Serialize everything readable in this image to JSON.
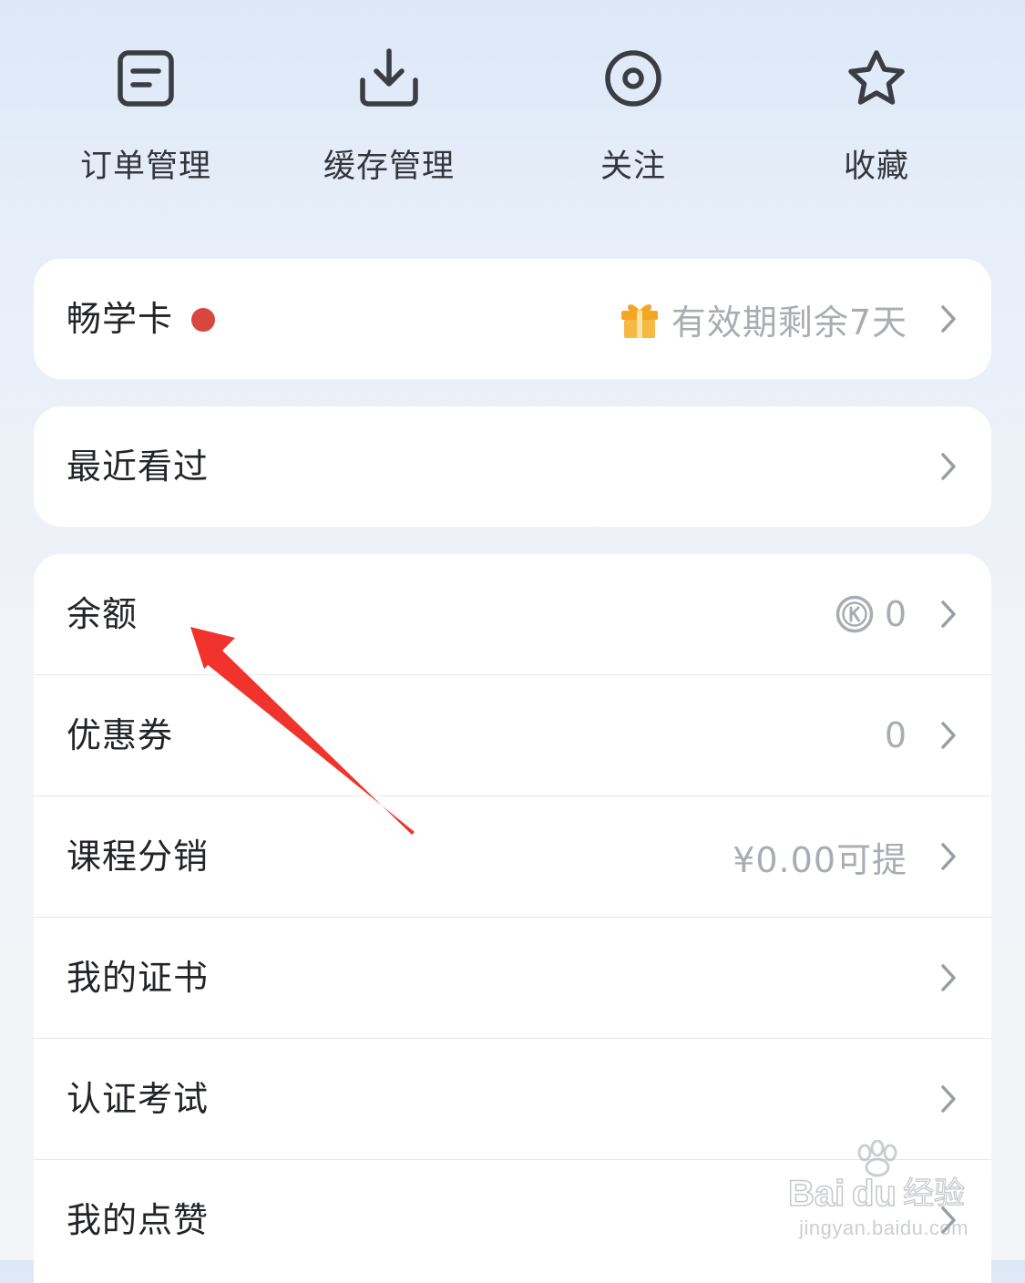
{
  "quick_actions": [
    {
      "label": "订单管理",
      "icon": "order-list-icon"
    },
    {
      "label": "缓存管理",
      "icon": "download-icon"
    },
    {
      "label": "关注",
      "icon": "follow-eye-icon"
    },
    {
      "label": "收藏",
      "icon": "star-icon"
    }
  ],
  "membership": {
    "label": "畅学卡",
    "status": "有效期剩余7天",
    "gift_icon": "gift-icon",
    "dot_color": "#d9453f"
  },
  "recent": {
    "label": "最近看过"
  },
  "account_items": [
    {
      "label": "余额",
      "value": "0",
      "icon": "coin-icon"
    },
    {
      "label": "优惠券",
      "value": "0"
    },
    {
      "label": "课程分销",
      "value": "¥0.00可提"
    },
    {
      "label": "我的证书",
      "value": ""
    },
    {
      "label": "认证考试",
      "value": ""
    },
    {
      "label": "我的点赞",
      "value": ""
    }
  ],
  "colors": {
    "accent_red": "#f0332c",
    "gift_orange": "#f5a623",
    "muted_text": "#a9acb2"
  },
  "watermark": {
    "brand": "Bai du 经验",
    "url": "jingyan.baidu.com"
  }
}
